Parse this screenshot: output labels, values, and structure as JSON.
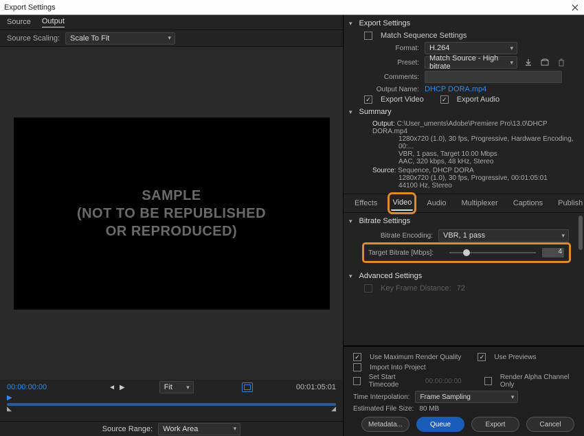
{
  "window": {
    "title": "Export Settings"
  },
  "left": {
    "tabs": {
      "source": "Source",
      "output": "Output"
    },
    "scaling_label": "Source Scaling:",
    "scaling_value": "Scale To Fit",
    "preview_line1": "SAMPLE",
    "preview_line2": "(NOT TO BE REPUBLISHED",
    "preview_line3": "OR REPRODUCED)",
    "tc_start": "00:00:00:00",
    "tc_end": "00:01:05:01",
    "fit_label": "Fit",
    "source_range_label": "Source Range:",
    "source_range_value": "Work Area"
  },
  "export": {
    "section_title": "Export Settings",
    "match_seq": "Match Sequence Settings",
    "format_label": "Format:",
    "format_value": "H.264",
    "preset_label": "Preset:",
    "preset_value": "Match Source - High bitrate",
    "comments_label": "Comments:",
    "outputname_label": "Output Name:",
    "outputname_value": "DHCP DORA.mp4",
    "export_video": "Export Video",
    "export_audio": "Export Audio"
  },
  "summary": {
    "title": "Summary",
    "output_label": "Output:",
    "output_l1": "C:\\User_uments\\Adobe\\Premiere Pro\\13.0\\DHCP DORA.mp4",
    "output_l2": "1280x720 (1.0), 30 fps, Progressive, Hardware Encoding, 00:...",
    "output_l3": "VBR, 1 pass, Target 10.00 Mbps",
    "output_l4": "AAC, 320 kbps, 48 kHz, Stereo",
    "source_label": "Source:",
    "source_l1": "Sequence, DHCP DORA",
    "source_l2": "1280x720 (1.0), 30 fps, Progressive, 00:01:05:01",
    "source_l3": "44100 Hz, Stereo"
  },
  "tabs": {
    "effects": "Effects",
    "video": "Video",
    "audio": "Audio",
    "multiplexer": "Multiplexer",
    "captions": "Captions",
    "publish": "Publish"
  },
  "bitrate": {
    "title": "Bitrate Settings",
    "encoding_label": "Bitrate Encoding:",
    "encoding_value": "VBR, 1 pass",
    "target_label": "Target Bitrate [Mbps]:",
    "target_value": "4"
  },
  "advanced": {
    "title": "Advanced Settings",
    "kfd_label": "Key Frame Distance:",
    "kfd_value": "72"
  },
  "bottom": {
    "max_quality": "Use Maximum Render Quality",
    "use_previews": "Use Previews",
    "import_project": "Import Into Project",
    "set_start_tc": "Set Start Timecode",
    "set_start_tc_val": "00:00:00:00",
    "render_alpha": "Render Alpha Channel Only",
    "time_interp_label": "Time Interpolation:",
    "time_interp_value": "Frame Sampling",
    "est_label": "Estimated File Size:",
    "est_value": "80 MB",
    "metadata": "Metadata...",
    "queue": "Queue",
    "export": "Export",
    "cancel": "Cancel"
  }
}
